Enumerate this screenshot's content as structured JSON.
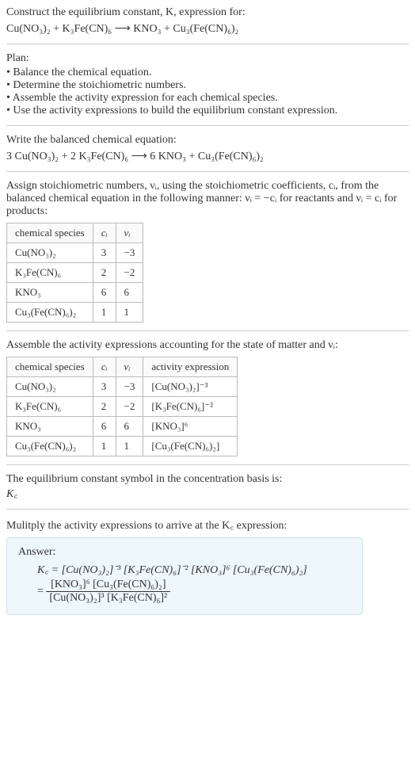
{
  "intro": {
    "line1": "Construct the equilibrium constant, K, expression for:",
    "equation": "Cu(NO₃)₂ + K₃Fe(CN)₆ ⟶ KNO₃ + Cu₃(Fe(CN)₆)₂"
  },
  "plan": {
    "heading": "Plan:",
    "items": [
      "Balance the chemical equation.",
      "Determine the stoichiometric numbers.",
      "Assemble the activity expression for each chemical species.",
      "Use the activity expressions to build the equilibrium constant expression."
    ]
  },
  "balanced": {
    "heading": "Write the balanced chemical equation:",
    "equation": "3 Cu(NO₃)₂ + 2 K₃Fe(CN)₆ ⟶ 6 KNO₃ + Cu₃(Fe(CN)₆)₂"
  },
  "stoich": {
    "text_a": "Assign stoichiometric numbers, νᵢ, using the stoichiometric coefficients, cᵢ, from the balanced chemical equation in the following manner: νᵢ = −cᵢ for reactants and νᵢ = cᵢ for products:",
    "headers": [
      "chemical species",
      "cᵢ",
      "νᵢ"
    ],
    "rows": [
      [
        "Cu(NO₃)₂",
        "3",
        "−3"
      ],
      [
        "K₃Fe(CN)₆",
        "2",
        "−2"
      ],
      [
        "KNO₃",
        "6",
        "6"
      ],
      [
        "Cu₃(Fe(CN)₆)₂",
        "1",
        "1"
      ]
    ]
  },
  "activity": {
    "heading": "Assemble the activity expressions accounting for the state of matter and νᵢ:",
    "headers": [
      "chemical species",
      "cᵢ",
      "νᵢ",
      "activity expression"
    ],
    "rows": [
      [
        "Cu(NO₃)₂",
        "3",
        "−3",
        "[Cu(NO₃)₂]⁻³"
      ],
      [
        "K₃Fe(CN)₆",
        "2",
        "−2",
        "[K₃Fe(CN)₆]⁻²"
      ],
      [
        "KNO₃",
        "6",
        "6",
        "[KNO₃]⁶"
      ],
      [
        "Cu₃(Fe(CN)₆)₂",
        "1",
        "1",
        "[Cu₃(Fe(CN)₆)₂]"
      ]
    ]
  },
  "kc_symbol": {
    "line1": "The equilibrium constant symbol in the concentration basis is:",
    "symbol": "K꜀"
  },
  "multiply": {
    "heading": "Mulitply the activity expressions to arrive at the K꜀ expression:"
  },
  "answer": {
    "label": "Answer:",
    "line1": "K꜀ = [Cu(NO₃)₂]⁻³ [K₃Fe(CN)₆]⁻² [KNO₃]⁶ [Cu₃(Fe(CN)₆)₂]",
    "frac_num": "[KNO₃]⁶ [Cu₃(Fe(CN)₆)₂]",
    "frac_den": "[Cu(NO₃)₂]³ [K₃Fe(CN)₆]²",
    "eq_prefix": "= "
  },
  "chart_data": {
    "type": "table",
    "tables": [
      {
        "title": "Stoichiometric numbers",
        "headers": [
          "chemical species",
          "c_i",
          "nu_i"
        ],
        "rows": [
          [
            "Cu(NO3)2",
            3,
            -3
          ],
          [
            "K3Fe(CN)6",
            2,
            -2
          ],
          [
            "KNO3",
            6,
            6
          ],
          [
            "Cu3(Fe(CN)6)2",
            1,
            1
          ]
        ]
      },
      {
        "title": "Activity expressions",
        "headers": [
          "chemical species",
          "c_i",
          "nu_i",
          "activity expression"
        ],
        "rows": [
          [
            "Cu(NO3)2",
            3,
            -3,
            "[Cu(NO3)2]^-3"
          ],
          [
            "K3Fe(CN)6",
            2,
            -2,
            "[K3Fe(CN)6]^-2"
          ],
          [
            "KNO3",
            6,
            6,
            "[KNO3]^6"
          ],
          [
            "Cu3(Fe(CN)6)2",
            1,
            1,
            "[Cu3(Fe(CN)6)2]"
          ]
        ]
      }
    ]
  }
}
